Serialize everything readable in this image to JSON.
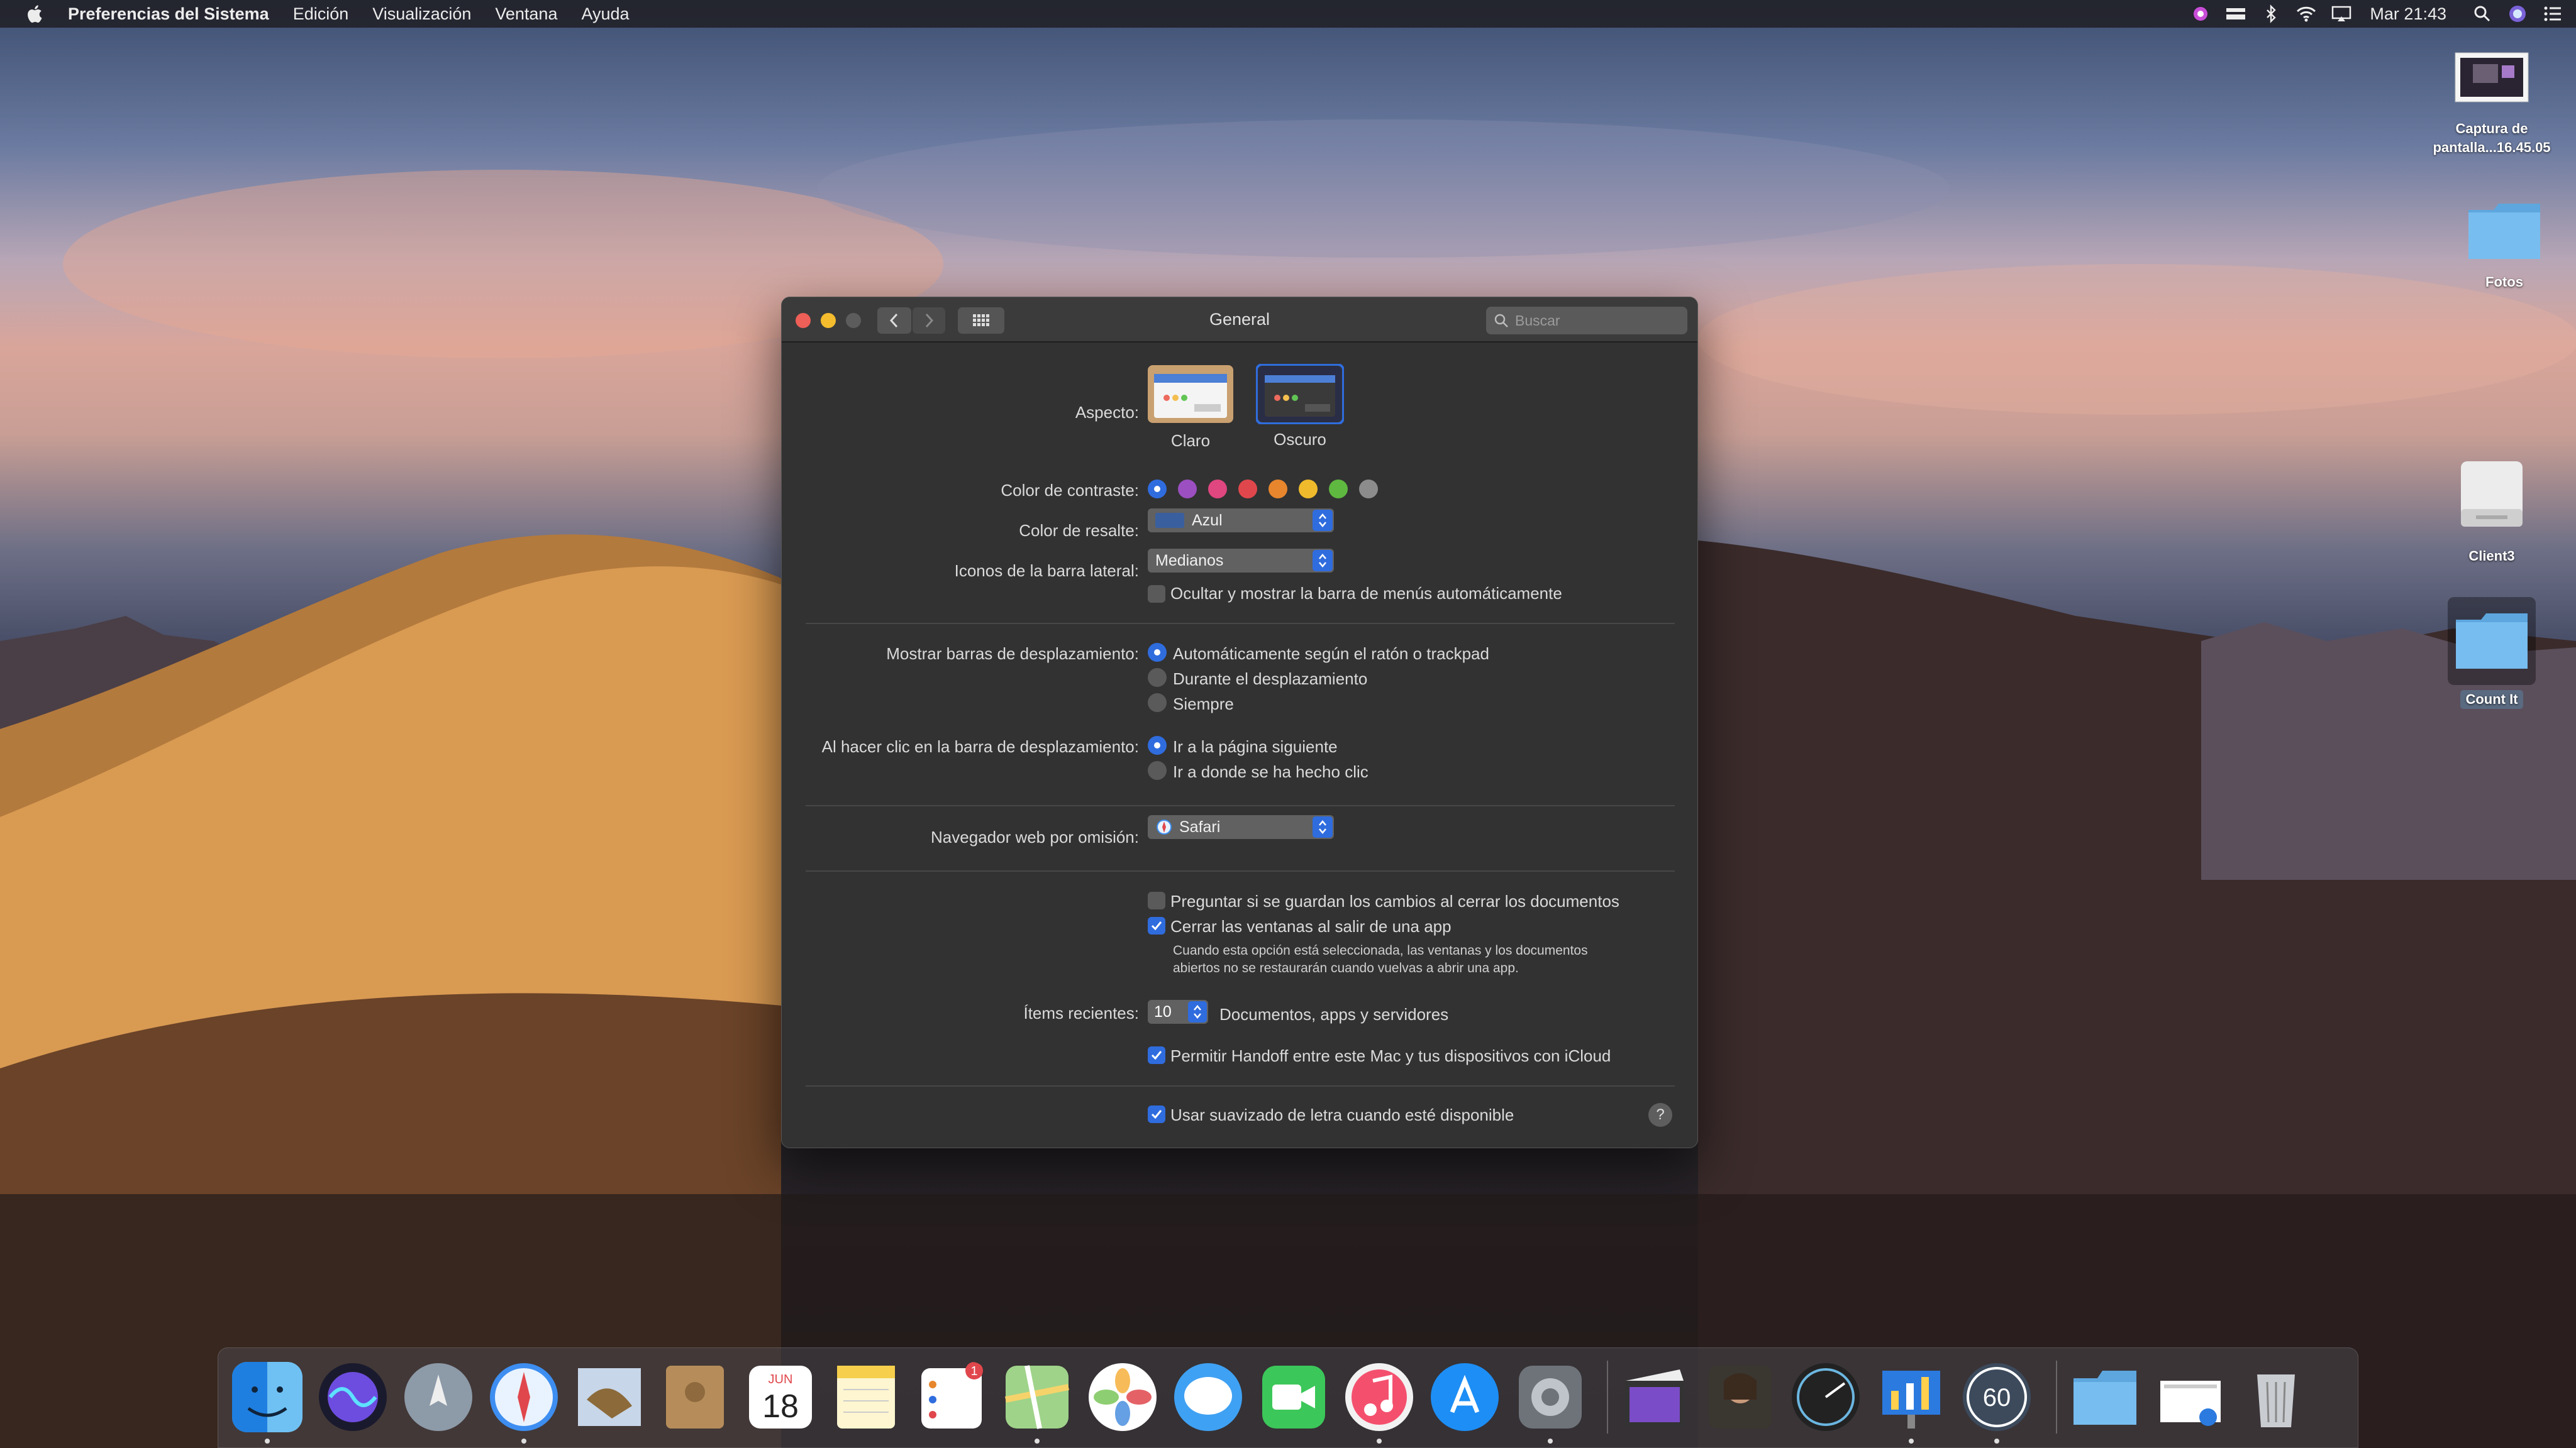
{
  "menubar": {
    "app_name": "Preferencias del Sistema",
    "menus": [
      "Edición",
      "Visualización",
      "Ventana",
      "Ayuda"
    ],
    "clock": "Mar 21:43",
    "status_icons": [
      "screen-recorder-icon",
      "menu-extra-icon",
      "bluetooth-icon",
      "wifi-icon",
      "airplay-icon"
    ]
  },
  "desktop": {
    "icons": [
      {
        "name": "screenshot-file",
        "label": "Captura de pantalla...16.45.05"
      },
      {
        "name": "folder-fotos",
        "label": "Fotos"
      },
      {
        "name": "drive-client3",
        "label": "Client3"
      },
      {
        "name": "folder-count-it",
        "label": "Count It"
      }
    ]
  },
  "window": {
    "title": "General",
    "search_placeholder": "Buscar",
    "appearance": {
      "label": "Aspecto:",
      "options": [
        {
          "label": "Claro"
        },
        {
          "label": "Oscuro"
        }
      ],
      "selected": "Oscuro"
    },
    "accent": {
      "label": "Color de contraste:",
      "colors": [
        "#2f6cde",
        "#9b4fc0",
        "#e0467f",
        "#e0474c",
        "#e7862d",
        "#efbb2c",
        "#5fb840",
        "#8c8c8c"
      ],
      "selected_index": 0
    },
    "highlight": {
      "label": "Color de resalte:",
      "value": "Azul",
      "swatch": "#3a5f9e"
    },
    "sidebar_icons": {
      "label": "Iconos de la barra lateral:",
      "value": "Medianos"
    },
    "autohide_menubar": {
      "label": "Ocultar y mostrar la barra de menús automáticamente",
      "checked": false
    },
    "scrollbars": {
      "label": "Mostrar barras de desplazamiento:",
      "options": [
        "Automáticamente según el ratón o trackpad",
        "Durante el desplazamiento",
        "Siempre"
      ],
      "selected_index": 0
    },
    "scroll_click": {
      "label": "Al hacer clic en la barra de desplazamiento:",
      "options": [
        "Ir a la página siguiente",
        "Ir a donde se ha hecho clic"
      ],
      "selected_index": 0
    },
    "browser": {
      "label": "Navegador web por omisión:",
      "value": "Safari"
    },
    "ask_save": {
      "label": "Preguntar si se guardan los cambios al cerrar los documentos",
      "checked": false
    },
    "close_windows": {
      "label": "Cerrar las ventanas al salir de una app",
      "checked": true
    },
    "close_windows_note_1": "Cuando esta opción está seleccionada, las ventanas y los documentos",
    "close_windows_note_2": "abiertos no se restaurarán cuando vuelvas a abrir una app.",
    "recent": {
      "label": "Ítems recientes:",
      "value": "10",
      "suffix": "Documentos, apps y servidores"
    },
    "handoff": {
      "label": "Permitir Handoff entre este Mac y tus dispositivos con iCloud",
      "checked": true
    },
    "font_smoothing": {
      "label": "Usar suavizado de letra cuando esté disponible",
      "checked": true
    },
    "help": "?"
  },
  "dock": {
    "items": [
      "finder",
      "siri",
      "launchpad",
      "safari",
      "mail",
      "contacts",
      "calendar",
      "notes",
      "reminders",
      "maps",
      "photos",
      "messages",
      "facetime",
      "itunes",
      "app-store",
      "system-preferences",
      "final-cut-pro",
      "game",
      "speed-test",
      "keynote",
      "fps-monitor",
      "downloads-folder",
      "preview",
      "trash"
    ],
    "calendar_month": "JUN",
    "calendar_day": "18",
    "reminders_badge": "1",
    "fps_label": "60"
  }
}
